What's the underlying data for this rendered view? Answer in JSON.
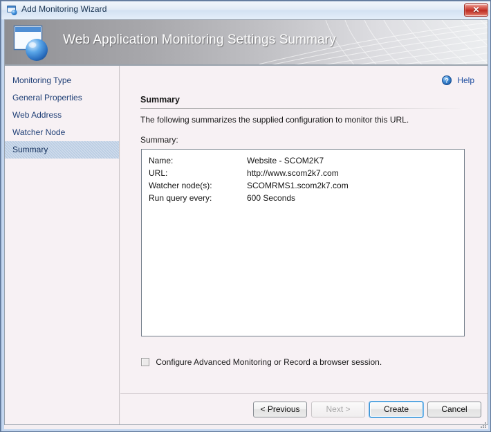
{
  "window": {
    "title": "Add Monitoring Wizard",
    "title_icon": "window-monitor-icon",
    "close_label": "✕"
  },
  "banner": {
    "title": "Web Application Monitoring Settings Summary",
    "icon": "web-application-globe-icon"
  },
  "sidebar": {
    "items": [
      {
        "label": "Monitoring Type",
        "selected": false
      },
      {
        "label": "General Properties",
        "selected": false
      },
      {
        "label": "Web Address",
        "selected": false
      },
      {
        "label": "Watcher Node",
        "selected": false
      },
      {
        "label": "Summary",
        "selected": true
      }
    ]
  },
  "main": {
    "help_label": "Help",
    "help_icon": "help-question-icon",
    "section_title": "Summary",
    "section_description": "The following summarizes the supplied configuration to monitor this URL.",
    "summary_label": "Summary:",
    "summary_rows": [
      {
        "key": "Name:",
        "value": "Website - SCOM2K7"
      },
      {
        "key": "URL:",
        "value": "http://www.scom2k7.com"
      },
      {
        "key": "Watcher node(s):",
        "value": "SCOMRMS1.scom2k7.com"
      },
      {
        "key": "Run query every:",
        "value": "600 Seconds"
      }
    ],
    "advanced_checkbox": {
      "label": "Configure Advanced Monitoring or Record a browser session.",
      "checked": false
    }
  },
  "footer": {
    "buttons": [
      {
        "id": "previous",
        "label": "< Previous",
        "state": "enabled"
      },
      {
        "id": "next",
        "label": "Next >",
        "state": "disabled"
      },
      {
        "id": "create",
        "label": "Create",
        "state": "default"
      },
      {
        "id": "cancel",
        "label": "Cancel",
        "state": "enabled"
      }
    ]
  },
  "colors": {
    "accent_blue": "#1f3f76",
    "selection_blue": "#b8cbe2",
    "link_blue": "#1b4b9e",
    "close_red": "#c8362b",
    "default_button_focus": "#3d92d4",
    "panel_bg": "#f7f1f4"
  }
}
